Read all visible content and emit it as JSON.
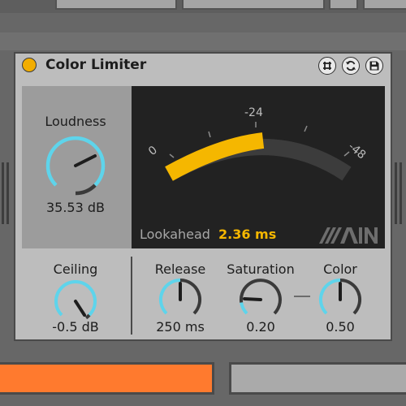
{
  "device": {
    "title": "Color Limiter",
    "accent_color": "#f5b700",
    "knob_color": "#5ed4eb",
    "buttons": [
      "hot-swap-icon",
      "refresh-icon",
      "save-icon"
    ]
  },
  "loudness": {
    "label": "Loudness",
    "value": "35.53 dB"
  },
  "meter": {
    "scale_labels": [
      "0",
      "-24",
      "-48"
    ],
    "level_fraction": 0.5,
    "lookahead_label": "Lookahead",
    "lookahead_value": "2.36 ms",
    "logo_text": "AIN"
  },
  "controls": [
    {
      "label": "Ceiling",
      "value": "-0.5 dB"
    },
    {
      "label": "Release",
      "value": "250 ms"
    },
    {
      "label": "Saturation",
      "value": "0.20"
    },
    {
      "label": "Color",
      "value": "0.50"
    }
  ]
}
